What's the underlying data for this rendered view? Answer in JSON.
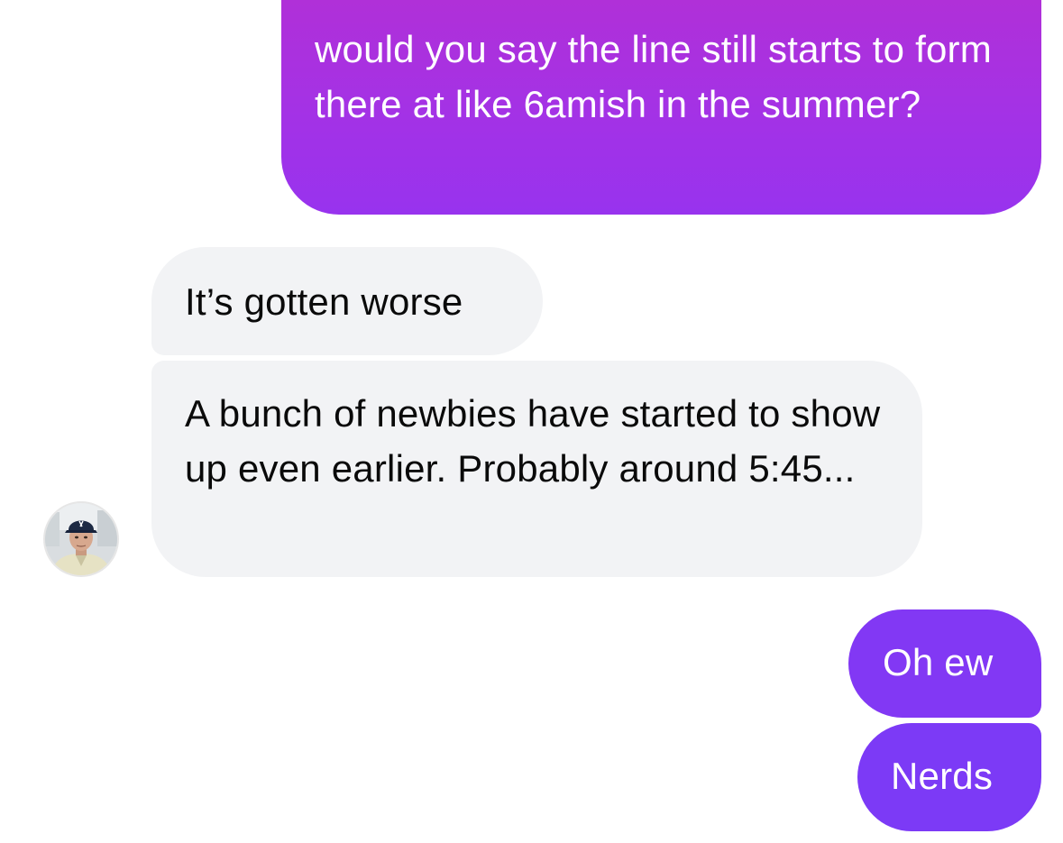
{
  "conversation": {
    "messages": [
      {
        "direction": "sent",
        "text": "would you say the line still starts to form there at like 6amish in the summer?"
      },
      {
        "direction": "received",
        "text": "It’s gotten worse"
      },
      {
        "direction": "received",
        "text": "A bunch of newbies have started to show up even earlier. Probably around 5:45..."
      },
      {
        "direction": "sent",
        "text": "Oh ew"
      },
      {
        "direction": "sent",
        "text": "Nerds"
      }
    ],
    "avatar": {
      "icon": "user-avatar-photo"
    }
  },
  "colors": {
    "sent_gradient_top": "#b030d8",
    "sent_gradient_bottom": "#9833ee",
    "sent_solid": "#7c3af6",
    "received_bg": "#f2f3f5",
    "received_text": "#0a0a0a",
    "sent_text": "#ffffff"
  }
}
